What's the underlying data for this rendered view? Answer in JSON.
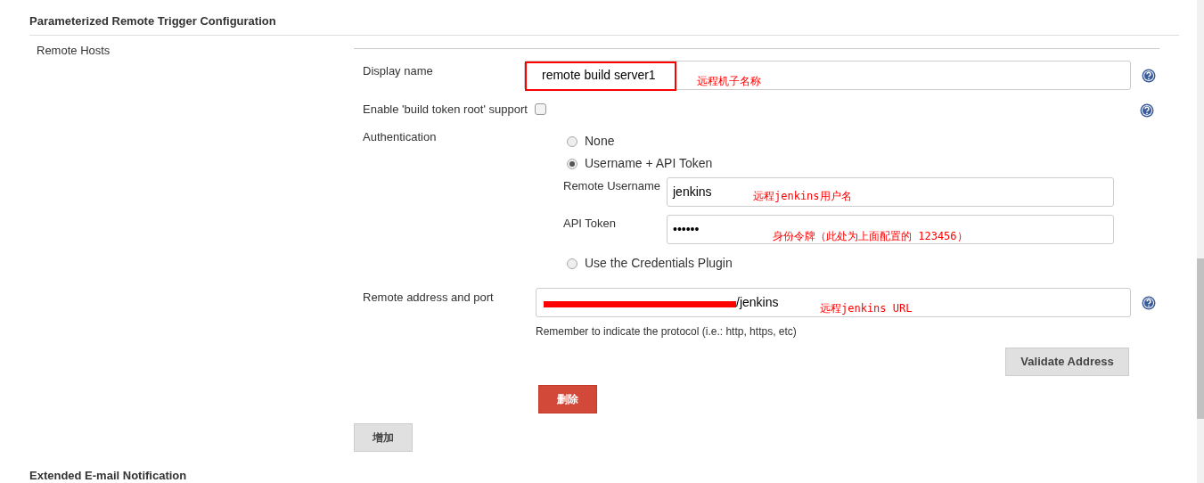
{
  "section_title": "Parameterized Remote Trigger Configuration",
  "remote_hosts_label": "Remote Hosts",
  "display_name": {
    "label": "Display name",
    "value": "remote build server1",
    "highlighted": true,
    "annotation": "远程机子名称"
  },
  "build_token_root": {
    "label": "Enable 'build token root' support",
    "checked": false
  },
  "authentication": {
    "label": "Authentication",
    "options": [
      {
        "label": "None",
        "selected": false
      },
      {
        "label": "Username + API Token",
        "selected": true
      },
      {
        "label": "Use the Credentials Plugin",
        "selected": false
      }
    ],
    "remote_username": {
      "label": "Remote Username",
      "value": "jenkins",
      "annotation": "远程jenkins用户名"
    },
    "api_token": {
      "label": "API Token",
      "value": "••••••",
      "annotation": "身份令牌（此处为上面配置的 123456）"
    }
  },
  "remote_address": {
    "label": "Remote address and port",
    "value": "/jenkins",
    "redacted": true,
    "annotation": "远程jenkins URL",
    "hint": "Remember to indicate the protocol (i.e.: http, https, etc)"
  },
  "buttons": {
    "validate": "Validate Address",
    "delete": "删除",
    "add": "增加"
  },
  "next_section_title": "Extended E-mail Notification"
}
